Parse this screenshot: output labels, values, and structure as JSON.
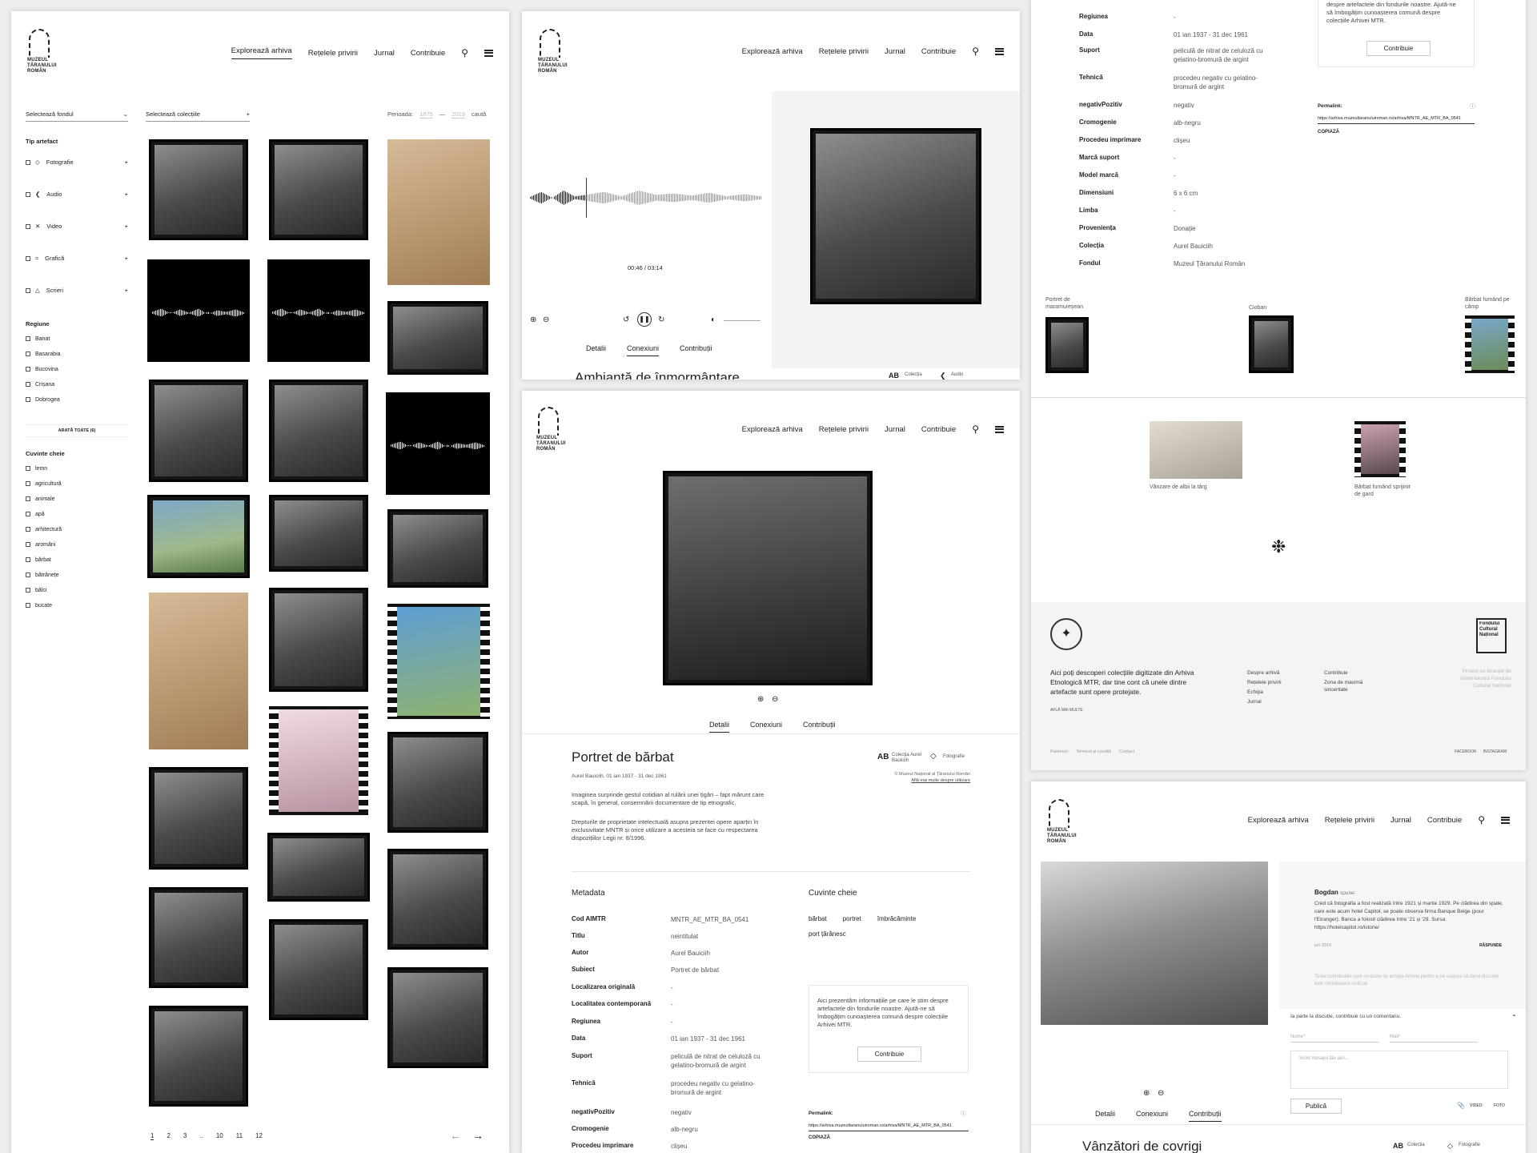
{
  "nav": {
    "explore": "Explorează arhiva",
    "networks": "Rețelele privirii",
    "journal": "Jurnal",
    "contribute": "Contribuie"
  },
  "logo_text": "MUZEUL ȚĂRANULUI ROMÂN",
  "browse": {
    "select_fond": "Selectează fondul",
    "select_coll": "Selectează colecțiile",
    "period_label": "Perioada:",
    "period_from": "1875",
    "period_to": "2019",
    "search": "caută",
    "type_heading": "Tip artefact",
    "types": [
      "Fotografie",
      "Audio",
      "Video",
      "Grafică",
      "Scrieri"
    ],
    "region_heading": "Regiune",
    "regions": [
      "Banat",
      "Basarabia",
      "Bucovina",
      "Crișana",
      "Dobrogea"
    ],
    "show_all": "ARATĂ TOATE (6)",
    "keywords_heading": "Cuvinte cheie",
    "keywords": [
      "lemn",
      "agricultură",
      "animale",
      "apă",
      "arhitectură",
      "aromâni",
      "bărbat",
      "bătrânețe",
      "bălci",
      "bucate"
    ],
    "pages": [
      "1",
      "2",
      "3",
      "..",
      "10",
      "11",
      "12"
    ]
  },
  "audio": {
    "time": "00:46 / 03:14",
    "tabs": [
      "Detalii",
      "Conexiuni",
      "Contribuții"
    ],
    "title_partial": "Ambianță de înmormântare",
    "collection_label": "Colecția",
    "type_label": "Audio"
  },
  "detail": {
    "tabs": [
      "Detalii",
      "Conexiuni",
      "Contribuții"
    ],
    "title": "Portret de bărbat",
    "subtitle": "Aurel Bauiciih, 01 ian 1937 - 31 dec 1961",
    "collection_label": "Colecția Aurel Bauiciih",
    "type_label": "Fotografie",
    "rights_line1": "© Muzeul Național al Țăranului Român",
    "rights_line2": "Află mai multe despre utilizare",
    "desc1": "Imaginea surprinde gestul cotidian al rulării unei țigări – fapt mărunt care scapă, în general, consemnării documentare de tip etnografic.",
    "desc2": "Drepturile de proprietate intelectuală asupra prezentei opere aparțin în exclusivitate MNTR și orice utilizare a acesteia se face cu respectarea dispozițiilor Legii nr. 8/1996.",
    "metadata_heading": "Metadata",
    "keywords_heading": "Cuvinte cheie",
    "keywords": [
      "bărbat",
      "portret",
      "îmbrăcăminte",
      "port țărănesc"
    ],
    "metadata": [
      [
        "Cod AIMTR",
        "MNTR_AE_MTR_BA_0541"
      ],
      [
        "Titlu",
        "neintitulat"
      ],
      [
        "Autor",
        "Aurel Bauiciih"
      ],
      [
        "Subiect",
        "Portret de bărbat"
      ],
      [
        "Localizarea originală",
        "-"
      ],
      [
        "Localitatea contemporană",
        "-"
      ],
      [
        "Regiunea",
        "-"
      ],
      [
        "Data",
        "01 ian 1937 - 31 dec 1961"
      ],
      [
        "Suport",
        "peliculă de nitrat de celuloză cu gelatino-bromură de argint"
      ],
      [
        "Tehnică",
        "procedeu negativ cu gelatino-bromură de argint"
      ],
      [
        "negativPozitiv",
        "negativ"
      ],
      [
        "Cromogenie",
        "alb-negru"
      ],
      [
        "Procedeu imprimare",
        "clișeu"
      ]
    ],
    "info_box": "Aici prezentăm informațiile pe care le știm despre artefactele din fondurile noastre. Ajută-ne să îmbogățim cunoașterea comună despre colecțiile Arhivei MTR.",
    "contribute_btn": "Contribuie",
    "permalink_label": "Permalink:",
    "permalink": "https://arhiva.muzeultaranuluiroman.ro/arhiva/MNTR_AE_MTR_BA_0541",
    "copy": "COPIAZĂ"
  },
  "metacont": {
    "rows": [
      [
        "Regiunea",
        "-"
      ],
      [
        "Data",
        "01 ian 1937 - 31 dec 1961"
      ],
      [
        "Suport",
        "peliculă de nitrat de celuloză cu gelatino-bromură de argint"
      ],
      [
        "Tehnică",
        "procedeu negativ cu gelatino-bromură de argint"
      ],
      [
        "negativPozitiv",
        "negativ"
      ],
      [
        "Cromogenie",
        "alb-negru"
      ],
      [
        "Procedeu imprimare",
        "clișeu"
      ],
      [
        "Marcă suport",
        "-"
      ],
      [
        "Model marcă",
        "-"
      ],
      [
        "Dimensiuni",
        "6 x 6 cm"
      ],
      [
        "Limba",
        "-"
      ],
      [
        "Proveniența",
        "Donație"
      ],
      [
        "Colecția",
        "Aurel Bauiciih"
      ],
      [
        "Fondul",
        "Muzeul Țăranului Român"
      ]
    ],
    "box_text": "despre artefactele din fondurile noastre. Ajută-ne să îmbogățim cunoașterea comună despre colecțiile Arhivei MTR.",
    "related": [
      "Portret de maramureșean",
      "Cioban",
      "Bărbat fumând pe câmp"
    ],
    "related2": [
      "Vânzare de albii la târg",
      "Bărbat fumând sprijinit de gard"
    ]
  },
  "footer": {
    "text": "Aici poți descoperi colecțiile digitizate din Arhiva Etnologică MTR, dar tine cont că unele dintre artefacte sunt opere protejate.",
    "more": "AFLĂ MAI MULTE",
    "col1": [
      "Despre arhivă",
      "Rețelele privirii",
      "Echipa",
      "Jurnal"
    ],
    "col2": [
      "Contribuie",
      "Zona de maximă sinceritate"
    ],
    "funded": "Proiect co-finanțat de Administrația Fondului Cultural Național",
    "afcn": "Fondului Cultural Național",
    "bottom": [
      "Parteneri",
      "Termeni și condiții",
      "Contact"
    ],
    "social": [
      "FACEBOOK",
      "INSTAGRAM"
    ]
  },
  "comments": {
    "author": "Bogdan",
    "says": "spune:",
    "text": "Cred că fotografia a fost realizată între 1921 și martie 1929. Pe clădirea din spate, care este acum hotel Capitol, se poate observa firma Banque Belge (pour l'Etranger). Banca a folosit clădirea între '21 și '29. Sursa: https://hotelcapitol.ro/istorie/",
    "date": "iun 2019",
    "reply": "RĂSPUNDE",
    "note": "Toate contribuțiile sunt revizuite de echipa Arhivei pentru a ne asigura că tonul discuției este întotdeauna civilizat.",
    "join": "Ia parte la discuție, contribuie cu un comentariu.",
    "name": "Nume*",
    "mail": "Mail*",
    "message": "Scrie mesajul tău aici...",
    "publish": "Publică",
    "video": "VIDEO",
    "foto": "FOTO",
    "tabs": [
      "Detalii",
      "Conexiuni",
      "Contribuții"
    ],
    "title_partial": "Vânzători de covrigi",
    "collection_label": "Colecția",
    "type_label": "Fotografie"
  }
}
